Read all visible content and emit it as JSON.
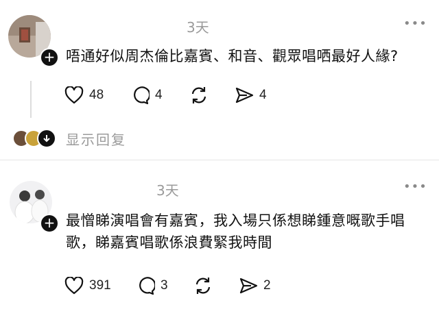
{
  "posts": [
    {
      "time": "3天",
      "content": "唔通好似周杰倫比嘉賓、和音、觀眾唱哂最好人緣?",
      "likes": "48",
      "comments": "4",
      "shares": "4"
    },
    {
      "time": "3天",
      "content": "最憎睇演唱會有嘉賓，我入場只係想睇鍾意嘅歌手唱歌，睇嘉賓唱歌係浪費緊我時間",
      "likes": "391",
      "comments": "3",
      "shares": "2"
    }
  ],
  "show_replies_label": "显示回复",
  "more_label": "•••",
  "colors": {
    "text": "#111111",
    "muted": "#9a9a9a",
    "badge": "#111111",
    "divider": "#e6e6e6"
  },
  "icons": [
    "heart-icon",
    "comment-icon",
    "repost-icon",
    "share-icon",
    "plus-icon",
    "more-icon",
    "chevron-down-icon"
  ]
}
